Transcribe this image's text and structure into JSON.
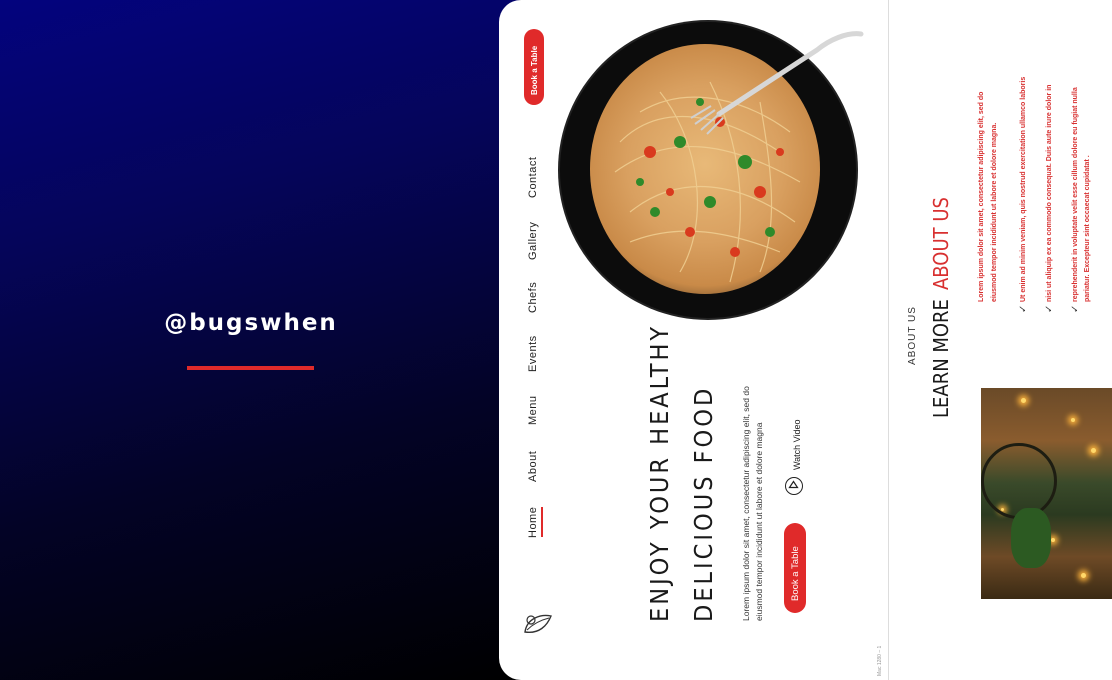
{
  "watermark": {
    "handle": "@bugswhen",
    "accent_color": "#e02a2a"
  },
  "page": {
    "top_button": "Book a Table",
    "nav": [
      {
        "label": "Home",
        "active": true
      },
      {
        "label": "About"
      },
      {
        "label": "Menu"
      },
      {
        "label": "Events"
      },
      {
        "label": "Chefs"
      },
      {
        "label": "Gallery"
      },
      {
        "label": "Contact"
      }
    ],
    "headline_line1": "ENJOY YOUR HEALTHY",
    "headline_line2": "DELICIOUS FOOD",
    "desc_line1": "Lorem ipsum dolor sit amet, consectetur adipiscing elit, sed do",
    "desc_line2": "eiusmod tempor incididunt ut labore et dolore magna",
    "book_button": "Book a Table",
    "watch_video": "Watch Video",
    "footer_tiny": "Mac 1280 – 1",
    "logo_icon": "leaf-logo-icon"
  },
  "about": {
    "eyebrow": "ABOUT US",
    "title_prefix": "LEARN MORE",
    "title_accent": "ABOUT US",
    "intro_line1": "Lorem ipsum dolor sit amet, consectetur adipiscing elit, sed do",
    "intro_line2": "eiusmod tempor incididunt ut labore et dolore magna.",
    "checks": [
      {
        "line1": "Ut enim ad minim veniam, quis nostrud exercitation ullamco laboris"
      },
      {
        "line1": "nisi ut aliquip ex ea commodo consequat. Duis aute irure dolor in"
      },
      {
        "line1": "reprehenderit in voluptate velit esse cillum dolore eu fugiat nulla",
        "line2": "pariatur. Excepteur sint occaecat cupidatat ."
      }
    ]
  }
}
